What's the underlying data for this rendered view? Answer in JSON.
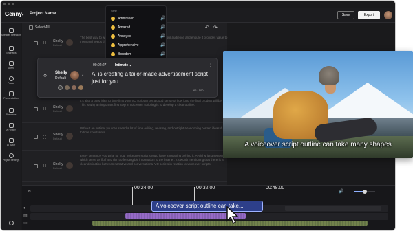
{
  "app": {
    "logo": "Genny",
    "logo_chevron": "▾",
    "project_name": "Project Name"
  },
  "header": {
    "save_label": "Save",
    "export_label": "Export"
  },
  "sidebar": {
    "items": [
      {
        "label": "Speaker Selection",
        "icon": "speaker-icon"
      },
      {
        "label": "Emphasis",
        "icon": "emphasis-icon"
      },
      {
        "label": "Speed",
        "icon": "speed-icon"
      },
      {
        "label": "Pause",
        "icon": "pause-icon"
      },
      {
        "label": "Pronunciation",
        "icon": "pronunciation-icon"
      },
      {
        "label": "Resource",
        "icon": "resource-icon"
      },
      {
        "label": "AI Writer",
        "icon": "ai-writer-icon"
      },
      {
        "label": "AI Actor",
        "icon": "ai-actor-icon"
      },
      {
        "label": "Project Settings",
        "icon": "settings-icon"
      }
    ]
  },
  "list": {
    "select_all": "Select All",
    "undo": "↶",
    "redo": "↷",
    "rows": [
      {
        "name": "Shelly",
        "sub": "Default",
        "text": "The best way to write a voiceover script is to make it all about your audience and ensure it provides value to them and keeps them hooked."
      },
      {
        "name": "Shelly",
        "sub": "Default",
        "text": "It's also a good idea to time-limit your VO script to get a good sense of how long the final product will be. This is why an important first step in voiceover scripting is to develop a clear outline."
      },
      {
        "name": "Shelly",
        "sub": "Default",
        "text": "Without an outline, you can spend a lot of time editing, revising, and outright abandoning certain ideas due to time constraints."
      },
      {
        "name": "Shelly",
        "sub": "Default",
        "text": "Every sentence you write for your voiceover script should have a meaning behind it. Avoid writing sentences which serve as fluff and don't offer tangible information to the listener. It's worth mentioning that there is a clear distinction between narrative and conversational VO scripts in relation to voiceover scripts."
      }
    ]
  },
  "style_menu": {
    "title": "Style",
    "items": [
      {
        "label": "Admiration",
        "icon": "smile-icon"
      },
      {
        "label": "Amazed",
        "icon": "smile-icon"
      },
      {
        "label": "Annoyed",
        "icon": "smile-icon"
      },
      {
        "label": "Apprehensive",
        "icon": "smile-icon"
      },
      {
        "label": "Boredom",
        "icon": "smile-icon"
      }
    ],
    "speaker_glyph": "🔊"
  },
  "editor": {
    "speaker_name": "Shelly",
    "speaker_style": "Default",
    "time": "00:02:27",
    "style": "Intimate",
    "style_chevron": "⌄",
    "speaker_chevron": "⌄",
    "more": "⋮",
    "text": "AI is creating a tailor-made advertisement script just for you.....",
    "char_count": "66 / 500"
  },
  "video": {
    "caption": "A voiceover script outline can take many shapes"
  },
  "timeline": {
    "marks": [
      "00:24.00",
      "00:32.00",
      "00:48.00"
    ],
    "caption_clip": "A voiceover script outline can take...",
    "volume_level": 0.5,
    "tools_glyph": "✂"
  },
  "colors": {
    "accent": "#2d3f8a",
    "caption_border": "#9fb3ff",
    "style_emoji": "#f0c040"
  }
}
